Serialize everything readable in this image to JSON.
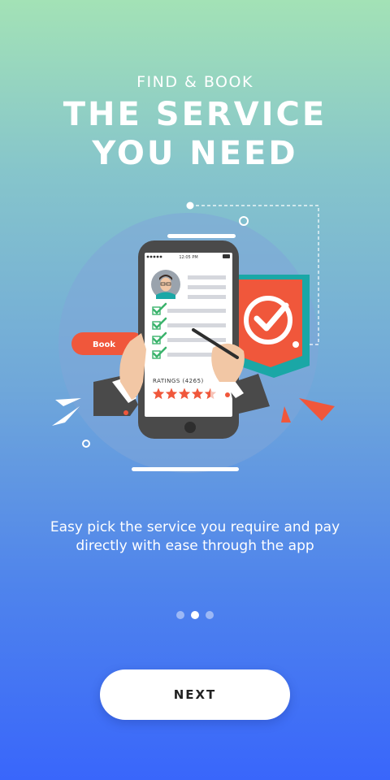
{
  "header": {
    "kicker": "FIND & BOOK",
    "title_line1": "THE SERVICE",
    "title_line2": "YOU NEED"
  },
  "illustration": {
    "book_label": "Book",
    "status_time": "12:05 PM",
    "ratings_label": "RATINGS (4265)",
    "rating_stars": 4.5,
    "colors": {
      "accent": "#f0573b",
      "teal": "#1aa7a6",
      "check": "#3bb36c",
      "phone": "#4a4a4a"
    }
  },
  "body": {
    "description_line1": "Easy pick the service you require and pay",
    "description_line2": "directly with ease through the app"
  },
  "pager": {
    "total": 3,
    "active_index": 1
  },
  "cta": {
    "next_label": "NEXT"
  }
}
